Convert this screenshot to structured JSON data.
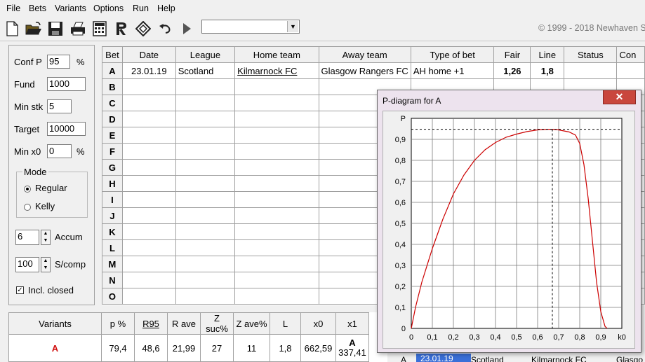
{
  "menu": [
    "File",
    "Bets",
    "Variants",
    "Options",
    "Run",
    "Help"
  ],
  "toolbar": {
    "icons": [
      "new-document-icon",
      "open-folder-icon",
      "save-icon",
      "print-icon",
      "calculator-icon",
      "r-icon",
      "diamond-icon",
      "undo-icon",
      "play-icon"
    ],
    "combo_value": "",
    "copyright": "© 1999 - 2018 Newhaven S"
  },
  "params": {
    "conf_p_label": "Conf P",
    "conf_p_value": "95",
    "conf_p_unit": "%",
    "fund_label": "Fund",
    "fund_value": "1000",
    "min_stk_label": "Min stk",
    "min_stk_value": "5",
    "target_label": "Target",
    "target_value": "10000",
    "min_x0_label": "Min x0",
    "min_x0_value": "0",
    "min_x0_unit": "%",
    "mode_label": "Mode",
    "mode_regular": "Regular",
    "mode_kelly": "Kelly",
    "accum_value": "6",
    "accum_label": "Accum",
    "scomp_value": "100",
    "scomp_label": "S/comp",
    "incl_closed_label": "Incl. closed",
    "incl_closed_checked": true
  },
  "bets": {
    "columns": [
      "Bet",
      "Date",
      "League",
      "Home team",
      "Away team",
      "Type of bet",
      "Fair",
      "Line",
      "Status",
      "Con"
    ],
    "rows": [
      {
        "id": "A",
        "date": "23.01.19",
        "league": "Scotland",
        "home": "Kilmarnock FC",
        "away": "Glasgow Rangers FC",
        "type": "AH home +1",
        "fair": "1,26",
        "line": "1,8",
        "status": "",
        "con": ""
      },
      {
        "id": "B"
      },
      {
        "id": "C"
      },
      {
        "id": "D"
      },
      {
        "id": "E"
      },
      {
        "id": "F"
      },
      {
        "id": "G"
      },
      {
        "id": "H"
      },
      {
        "id": "I"
      },
      {
        "id": "J"
      },
      {
        "id": "K"
      },
      {
        "id": "L"
      },
      {
        "id": "M"
      },
      {
        "id": "N"
      },
      {
        "id": "O"
      }
    ]
  },
  "variants": {
    "columns": [
      "Variants",
      "p %",
      "R95",
      "R ave",
      "Z suc%",
      "Z ave%",
      "L",
      "x0",
      "x1"
    ],
    "rows": [
      {
        "name": "A",
        "p": "79,4",
        "r95": "48,6",
        "rave": "21,99",
        "zsuc": "27",
        "zave": "11",
        "l": "1,8",
        "x0": "662,59",
        "x1_top": "A",
        "x1": "337,41"
      }
    ]
  },
  "underlying_row": {
    "id": "A",
    "date": "23.01.19",
    "league": "Scotland",
    "home": "Kilmarnock FC",
    "away": "Glasgo"
  },
  "dialog": {
    "title": "P-diagram for A",
    "close_label": "✕"
  },
  "chart_data": {
    "type": "line",
    "title": "",
    "xlabel": "k0",
    "ylabel": "P",
    "xlim": [
      0,
      1.0
    ],
    "ylim": [
      0,
      1.0
    ],
    "x_ticks": [
      "0",
      "0,1",
      "0,2",
      "0,3",
      "0,4",
      "0,5",
      "0,6",
      "0,7",
      "0,8",
      "0,9",
      "k0"
    ],
    "y_ticks": [
      "0",
      "0,1",
      "0,2",
      "0,3",
      "0,4",
      "0,5",
      "0,6",
      "0,7",
      "0,8",
      "0,9",
      "P"
    ],
    "grid": true,
    "series": [
      {
        "color": "#cc0000",
        "x": [
          0,
          0.02,
          0.05,
          0.1,
          0.15,
          0.2,
          0.25,
          0.3,
          0.35,
          0.4,
          0.45,
          0.5,
          0.55,
          0.6,
          0.65,
          0.67,
          0.7,
          0.75,
          0.78,
          0.8,
          0.82,
          0.84,
          0.86,
          0.88,
          0.9,
          0.92,
          0.93
        ],
        "y": [
          0,
          0.1,
          0.22,
          0.38,
          0.52,
          0.64,
          0.73,
          0.8,
          0.85,
          0.885,
          0.91,
          0.925,
          0.937,
          0.945,
          0.948,
          0.948,
          0.945,
          0.935,
          0.92,
          0.88,
          0.78,
          0.62,
          0.42,
          0.22,
          0.08,
          0.01,
          0
        ]
      }
    ],
    "crosshair": {
      "x": 0.67,
      "y": 0.948,
      "color": "#000000"
    }
  }
}
